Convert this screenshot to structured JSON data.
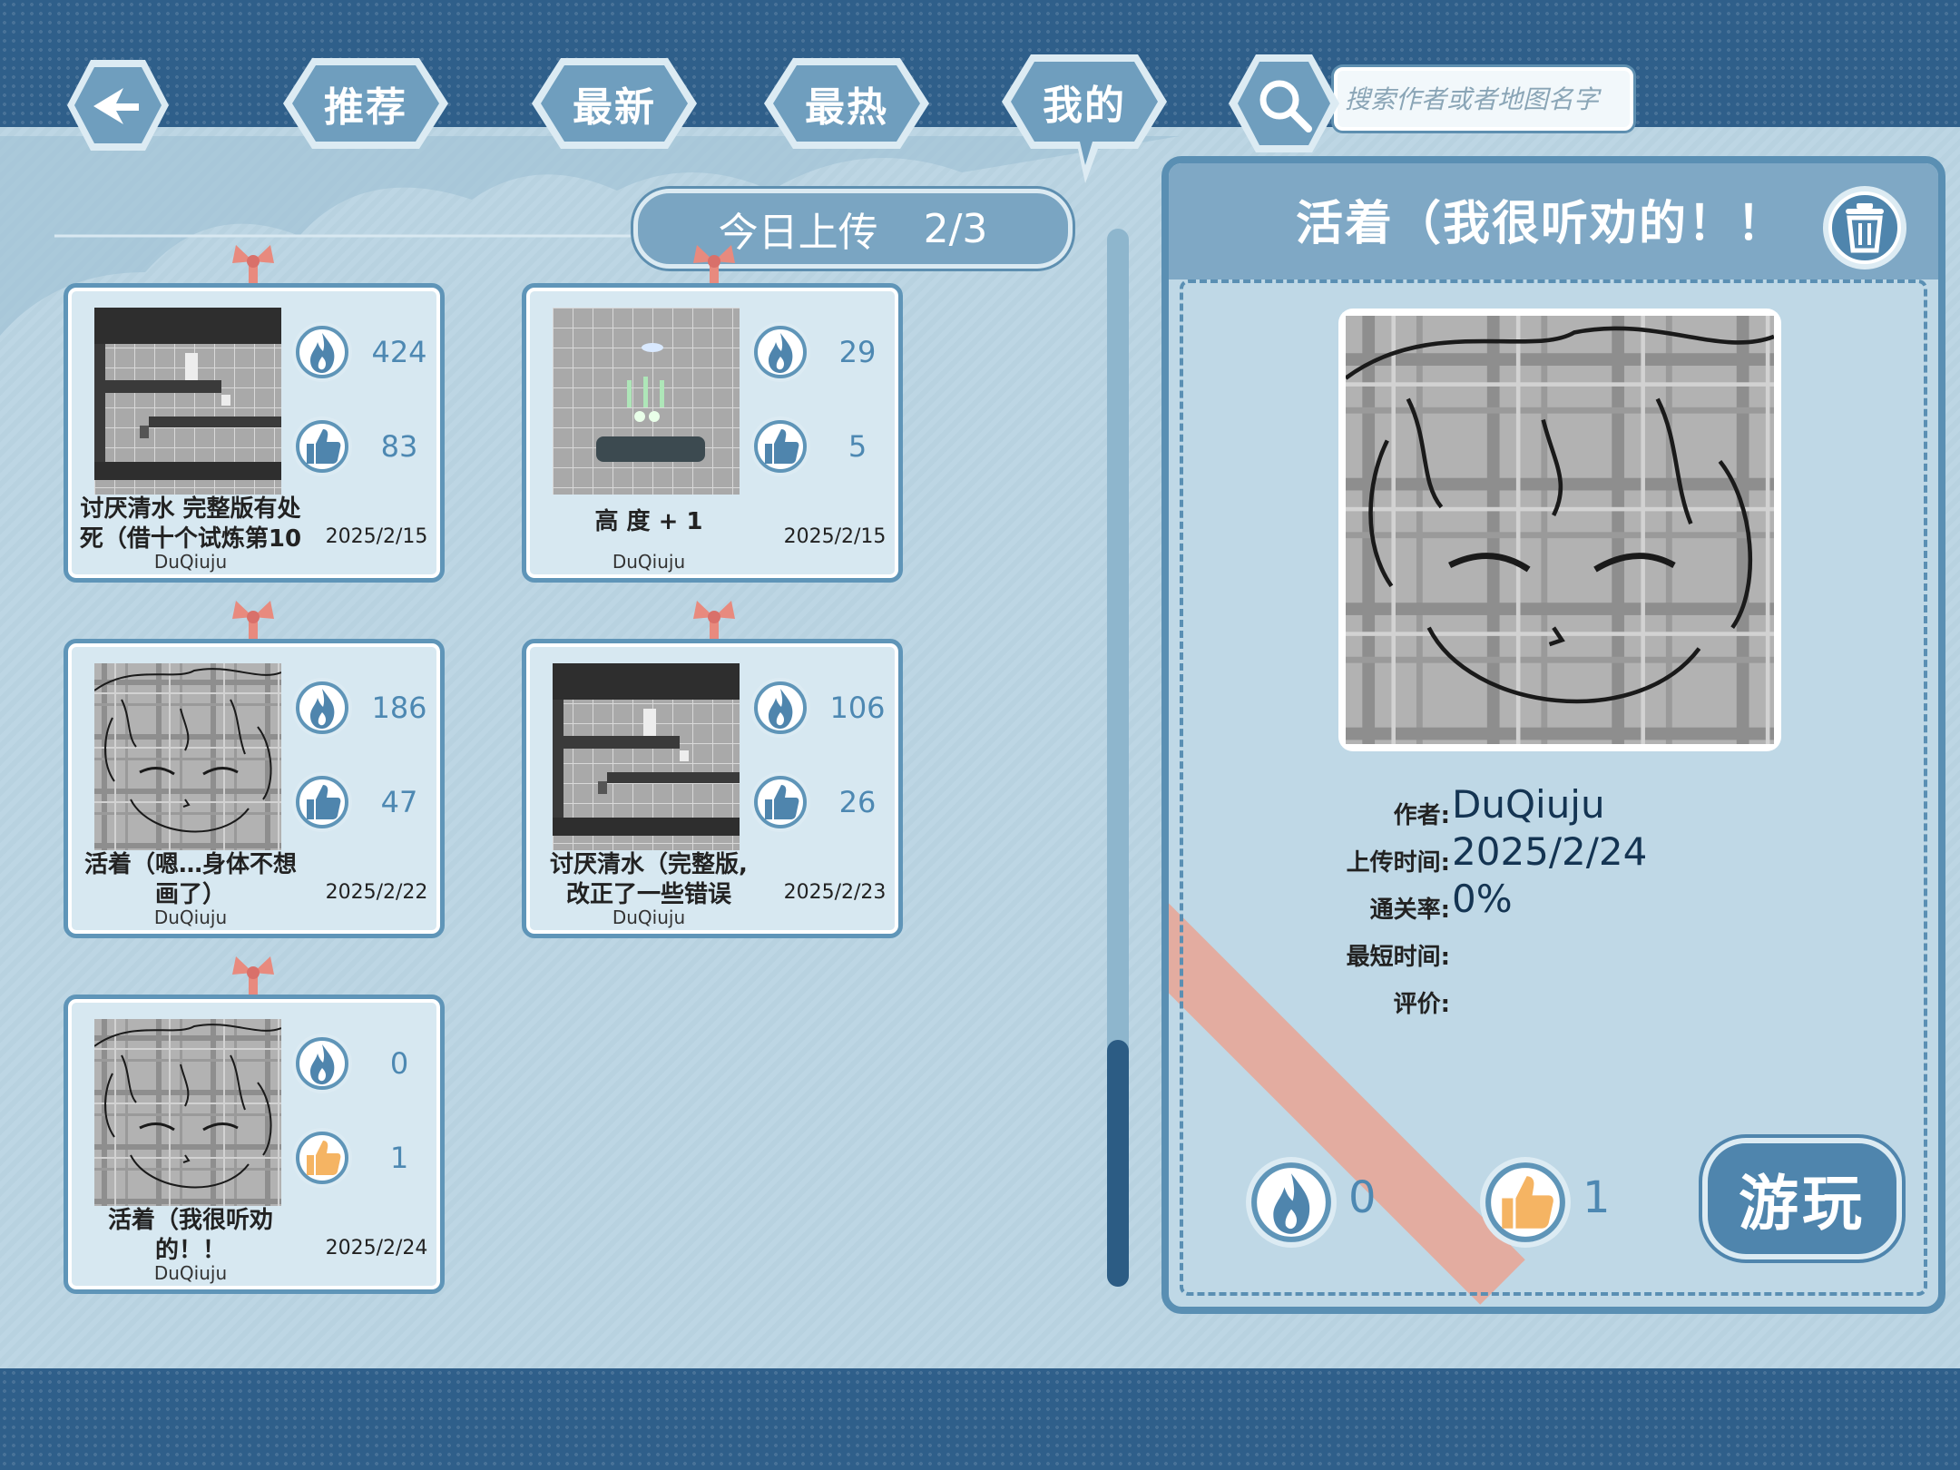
{
  "nav": {
    "tab_recommend": "推荐",
    "tab_latest": "最新",
    "tab_hot": "最热",
    "tab_mine": "我的",
    "search_placeholder": "搜索作者或者地图名字"
  },
  "upload": {
    "label": "今日上传",
    "count": "2/3"
  },
  "maps": [
    {
      "title_line1": "讨厌清水 完整版有处",
      "title_line2": "死（借十个试炼第10",
      "author": "DuQiuju",
      "date": "2025/2/15",
      "hot": "424",
      "likes": "83",
      "thumb_icon": "map-thumbnail-dark-level"
    },
    {
      "title_line1": "高 度 + 1",
      "title_line2": "",
      "author": "DuQiuju",
      "date": "2025/2/15",
      "hot": "29",
      "likes": "5",
      "thumb_icon": "map-thumbnail-grid-level"
    },
    {
      "title_line1": "活着（嗯…身体不想",
      "title_line2": "画了）",
      "author": "DuQiuju",
      "date": "2025/2/22",
      "hot": "186",
      "likes": "47",
      "thumb_icon": "map-thumbnail-sketch-face"
    },
    {
      "title_line1": "讨厌清水（完整版,",
      "title_line2": "改正了一些错误",
      "author": "DuQiuju",
      "date": "2025/2/23",
      "hot": "106",
      "likes": "26",
      "thumb_icon": "map-thumbnail-dark-level"
    },
    {
      "title_line1": "活着（我很听劝",
      "title_line2": "的！！",
      "author": "DuQiuju",
      "date": "2025/2/24",
      "hot": "0",
      "likes": "1",
      "thumb_icon": "map-thumbnail-sketch-face"
    }
  ],
  "detail": {
    "title": "活着（我很听劝的！！",
    "author_label": "作者:",
    "author": "DuQiuju",
    "upload_time_label": "上传时间:",
    "upload_time": "2025/2/24",
    "clear_rate_label": "通关率:",
    "clear_rate": "0%",
    "best_time_label": "最短时间:",
    "best_time": "",
    "rating_label": "评价:",
    "rating": "",
    "hot": "0",
    "likes": "1",
    "play_label": "游玩"
  },
  "colors": {
    "band": "#2f5f8a",
    "panel": "#5a8fb3",
    "accent_number": "#4d88b2",
    "liked_icon": "#f5b463",
    "pin": "#e88a7e"
  },
  "icons": [
    "back-arrow-icon",
    "search-icon",
    "flame-icon",
    "thumbs-up-icon",
    "trash-icon",
    "pin-icon"
  ]
}
